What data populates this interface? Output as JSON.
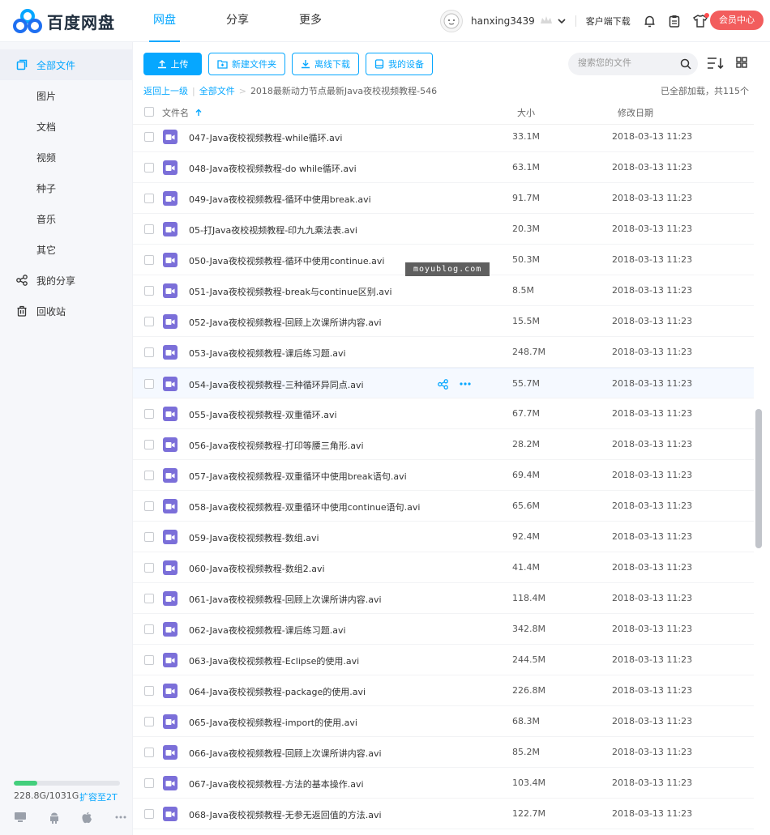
{
  "header": {
    "brand": "百度网盘",
    "nav": [
      {
        "label": "网盘",
        "active": true
      },
      {
        "label": "分享",
        "active": false
      },
      {
        "label": "更多",
        "active": false
      }
    ],
    "username": "hanxing3439",
    "client_download": "客户端下载",
    "vip_center": "会员中心"
  },
  "sidebar": {
    "items": [
      {
        "label": "全部文件",
        "icon": "folder-icon",
        "active": true
      },
      {
        "label": "图片"
      },
      {
        "label": "文档"
      },
      {
        "label": "视频"
      },
      {
        "label": "种子"
      },
      {
        "label": "音乐"
      },
      {
        "label": "其它"
      },
      {
        "label": "我的分享",
        "icon": "share-icon"
      },
      {
        "label": "回收站",
        "icon": "trash-icon"
      }
    ],
    "storage_text": "228.8G/1031G",
    "storage_fraction": 0.222,
    "expand_link": "扩容至2T"
  },
  "toolbar": {
    "upload": "上传",
    "new_folder": "新建文件夹",
    "offline_download": "离线下载",
    "my_devices": "我的设备",
    "search_placeholder": "搜索您的文件"
  },
  "breadcrumb": {
    "back": "返回上一级",
    "all_files": "全部文件",
    "current": "2018最新动力节点最新Java夜校视频教程-546",
    "loaded": "已全部加载，共115个"
  },
  "table": {
    "col_name": "文件名",
    "col_size": "大小",
    "col_date": "修改日期",
    "rows": [
      {
        "name": "047-Java夜校视频教程-while循环.avi",
        "size": "33.1M",
        "date": "2018-03-13 11:23"
      },
      {
        "name": "048-Java夜校视频教程-do while循环.avi",
        "size": "63.1M",
        "date": "2018-03-13 11:23"
      },
      {
        "name": "049-Java夜校视频教程-循环中使用break.avi",
        "size": "91.7M",
        "date": "2018-03-13 11:23"
      },
      {
        "name": "05-打Java夜校视频教程-印九九乘法表.avi",
        "size": "20.3M",
        "date": "2018-03-13 11:23"
      },
      {
        "name": "050-Java夜校视频教程-循环中使用continue.avi",
        "size": "50.3M",
        "date": "2018-03-13 11:23"
      },
      {
        "name": "051-Java夜校视频教程-break与continue区别.avi",
        "size": "8.5M",
        "date": "2018-03-13 11:23"
      },
      {
        "name": "052-Java夜校视频教程-回顾上次课所讲内容.avi",
        "size": "15.5M",
        "date": "2018-03-13 11:23"
      },
      {
        "name": "053-Java夜校视频教程-课后练习题.avi",
        "size": "248.7M",
        "date": "2018-03-13 11:23"
      },
      {
        "name": "054-Java夜校视频教程-三种循环异同点.avi",
        "size": "55.7M",
        "date": "2018-03-13 11:23",
        "hover": true
      },
      {
        "name": "055-Java夜校视频教程-双重循环.avi",
        "size": "67.7M",
        "date": "2018-03-13 11:23"
      },
      {
        "name": "056-Java夜校视频教程-打印等腰三角形.avi",
        "size": "28.2M",
        "date": "2018-03-13 11:23"
      },
      {
        "name": "057-Java夜校视频教程-双重循环中使用break语句.avi",
        "size": "69.4M",
        "date": "2018-03-13 11:23"
      },
      {
        "name": "058-Java夜校视频教程-双重循环中使用continue语句.avi",
        "size": "65.6M",
        "date": "2018-03-13 11:23"
      },
      {
        "name": "059-Java夜校视频教程-数组.avi",
        "size": "92.4M",
        "date": "2018-03-13 11:23"
      },
      {
        "name": "060-Java夜校视频教程-数组2.avi",
        "size": "41.4M",
        "date": "2018-03-13 11:23"
      },
      {
        "name": "061-Java夜校视频教程-回顾上次课所讲内容.avi",
        "size": "118.4M",
        "date": "2018-03-13 11:23"
      },
      {
        "name": "062-Java夜校视频教程-课后练习题.avi",
        "size": "342.8M",
        "date": "2018-03-13 11:23"
      },
      {
        "name": "063-Java夜校视频教程-Eclipse的使用.avi",
        "size": "244.5M",
        "date": "2018-03-13 11:23"
      },
      {
        "name": "064-Java夜校视频教程-package的使用.avi",
        "size": "226.8M",
        "date": "2018-03-13 11:23"
      },
      {
        "name": "065-Java夜校视频教程-import的使用.avi",
        "size": "68.3M",
        "date": "2018-03-13 11:23"
      },
      {
        "name": "066-Java夜校视频教程-回顾上次课所讲内容.avi",
        "size": "85.2M",
        "date": "2018-03-13 11:23"
      },
      {
        "name": "067-Java夜校视频教程-方法的基本操作.avi",
        "size": "103.4M",
        "date": "2018-03-13 11:23"
      },
      {
        "name": "068-Java夜校视频教程-无参无返回值的方法.avi",
        "size": "122.7M",
        "date": "2018-03-13 11:23"
      }
    ]
  },
  "watermark": "moyublog.com",
  "colors": {
    "accent": "#06a7ff",
    "vip": "#f25d5d",
    "video_icon": "#7b6fd9",
    "storage": "#43cf7c"
  }
}
